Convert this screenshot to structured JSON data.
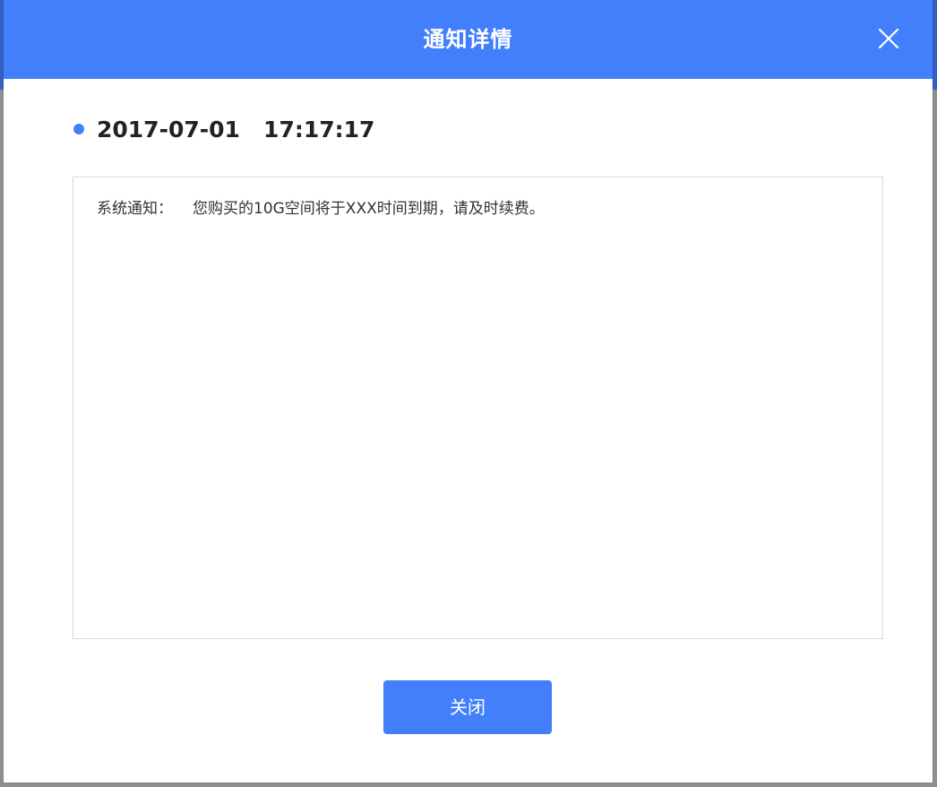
{
  "modal": {
    "title": "通知详情",
    "close_icon": "close-icon"
  },
  "notice": {
    "date": "2017-07-01",
    "time": "17:17:17",
    "label": "系统通知：",
    "message": "您购买的10G空间将于XXX时间到期，请及时续费。"
  },
  "footer": {
    "close_label": "关闭"
  },
  "colors": {
    "accent": "#447ffb",
    "backdrop": "#8e8e93",
    "border": "#d9d9d9",
    "text": "#333333"
  }
}
